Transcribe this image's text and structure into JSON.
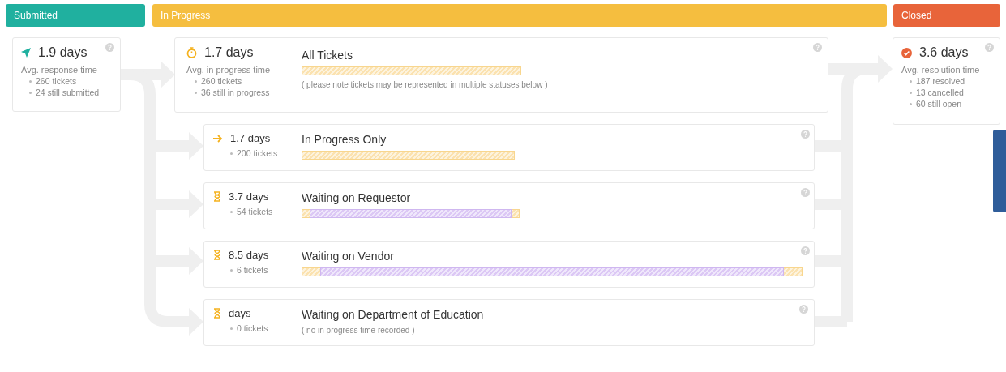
{
  "stages": [
    {
      "label": "Submitted",
      "color": "#20b09f"
    },
    {
      "label": "In Progress",
      "color": "#f5be3f"
    },
    {
      "label": "Closed",
      "color": "#e8643a"
    }
  ],
  "submitted": {
    "value": "1.9 days",
    "caption": "Avg. response time",
    "stats": [
      "260 tickets",
      "24 still submitted"
    ]
  },
  "in_progress": {
    "value": "1.7 days",
    "caption": "Avg. in progress time",
    "stats": [
      "260 tickets",
      "36 still in progress"
    ],
    "title": "All Tickets",
    "bar": {
      "waiting": false
    },
    "note": "( please note tickets may be represented in multiple statuses below )"
  },
  "statuses": [
    {
      "kind": "arrow",
      "value": "1.7 days",
      "count": "200 tickets",
      "title": "In Progress Only",
      "bar": {
        "waiting": false
      }
    },
    {
      "kind": "hourglass",
      "value": "3.7 days",
      "count": "54 tickets",
      "title": "Waiting on Requestor",
      "bar": {
        "waiting": true
      }
    },
    {
      "kind": "hourglass",
      "value": "8.5 days",
      "count": "6 tickets",
      "title": "Waiting on Vendor",
      "bar": {
        "waiting": true
      }
    },
    {
      "kind": "hourglass",
      "value": "days",
      "count": "0 tickets",
      "title": "Waiting on Department of Education",
      "note": "( no in progress time recorded )"
    }
  ],
  "closed": {
    "value": "3.6 days",
    "caption": "Avg. resolution time",
    "stats": [
      "187 resolved",
      "13 cancelled",
      "60 still open"
    ]
  }
}
